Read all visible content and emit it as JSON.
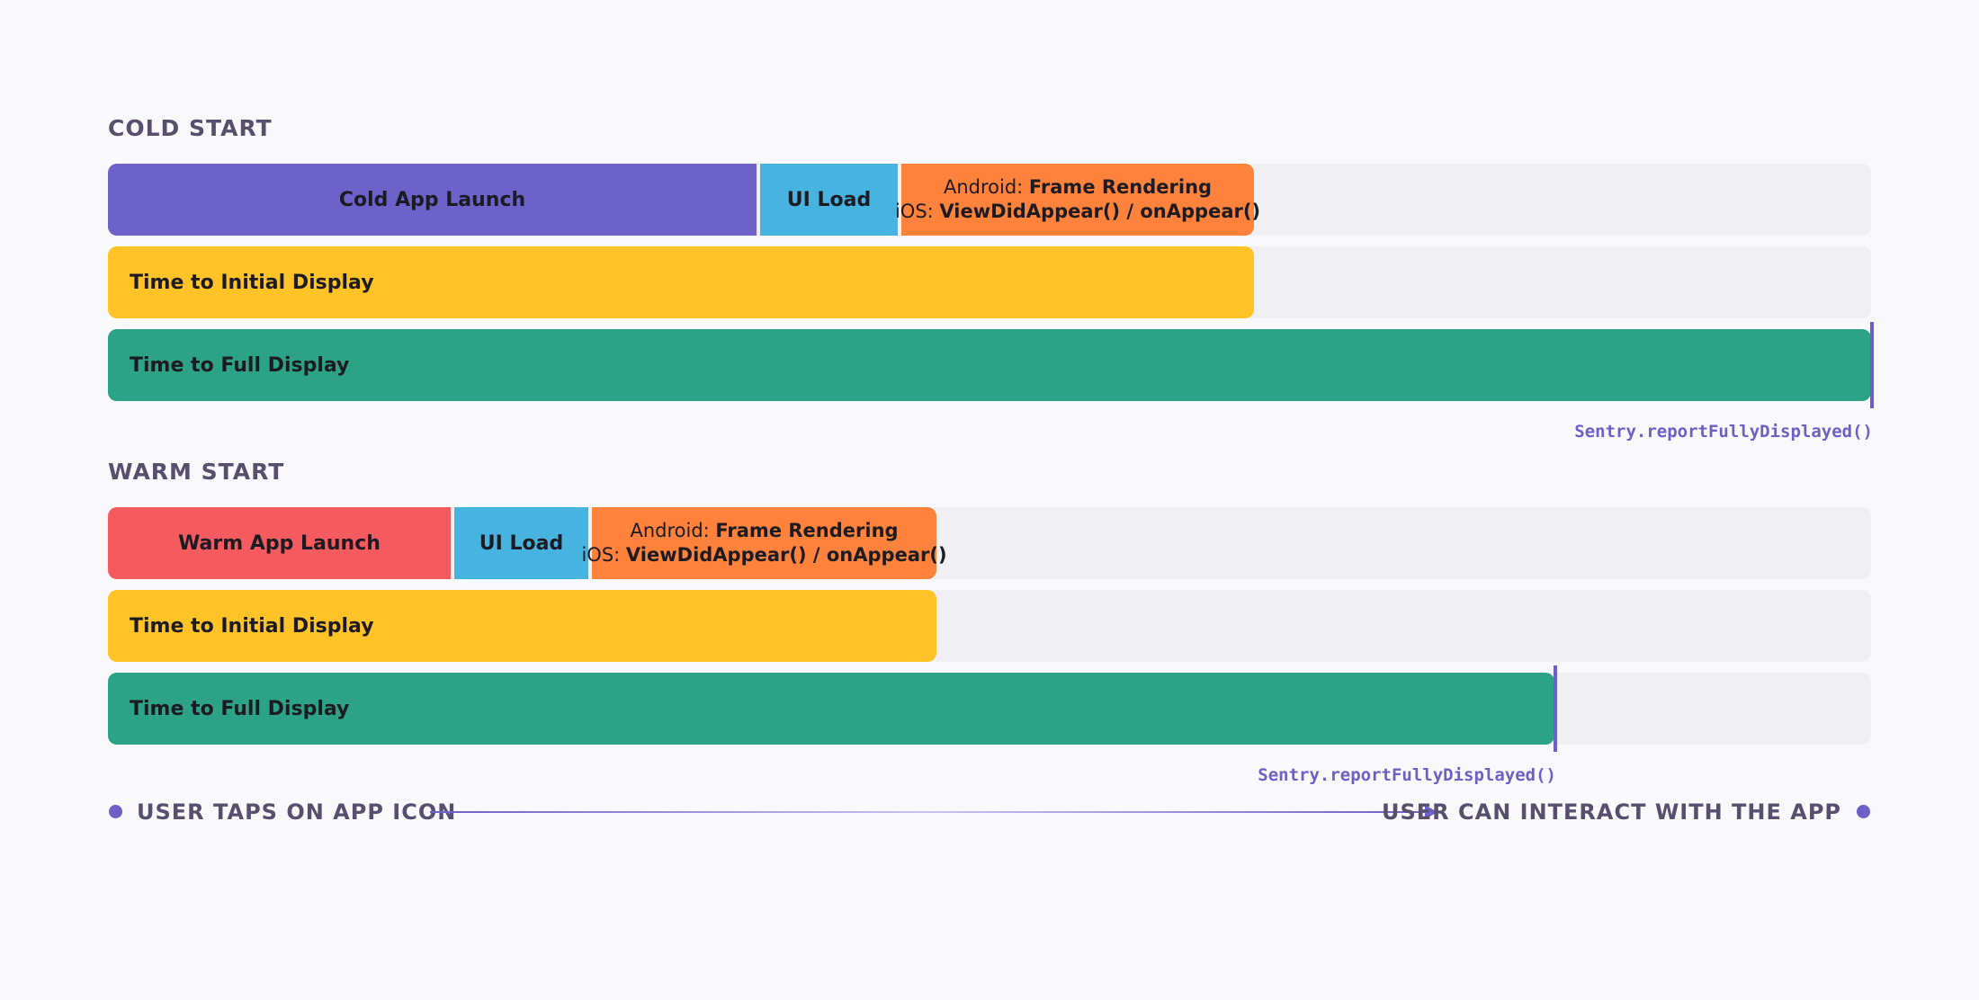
{
  "cold": {
    "title": "COLD START",
    "app_launch": "Cold App Launch",
    "ui_load": "UI Load",
    "frame_android_prefix": "Android: ",
    "frame_android_value": "Frame Rendering",
    "frame_ios_prefix": "iOS: ",
    "frame_ios_value": "ViewDidAppear() / onAppear()",
    "initial_display": "Time to Initial Display",
    "full_display": "Time to Full Display",
    "marker_label": "Sentry.reportFullyDisplayed()"
  },
  "warm": {
    "title": "WARM START",
    "app_launch": "Warm App Launch",
    "ui_load": "UI Load",
    "frame_android_prefix": "Android: ",
    "frame_android_value": "Frame Rendering",
    "frame_ios_prefix": "iOS: ",
    "frame_ios_value": "ViewDidAppear() / onAppear()",
    "initial_display": "Time to Initial Display",
    "full_display": "Time to Full Display",
    "marker_label": "Sentry.reportFullyDisplayed()"
  },
  "flow": {
    "start": "USER TAPS ON APP ICON",
    "end": "USER CAN INTERACT WITH THE APP"
  },
  "colors": {
    "cold_launch": "#6c62c9",
    "warm_launch": "#f55a5e",
    "ui_load": "#46b3e1",
    "frame_rendering": "#fe823b",
    "initial_display": "#ffc227",
    "full_display": "#2ca387",
    "accent": "#6c5fc7"
  }
}
